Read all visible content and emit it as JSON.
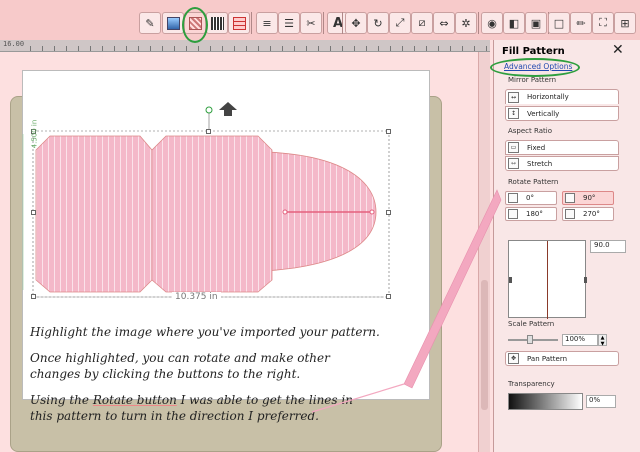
{
  "toolbar": {
    "buttons": [
      "fill-pen-icon",
      "color-swatch-icon",
      "fill-pattern-icon",
      "pattern-hatch-icon",
      "pattern-grid-icon",
      "line-style-icon",
      "dash-style-icon",
      "scissors-icon",
      "text-icon",
      "move-icon",
      "rotate-icon",
      "resize-icon",
      "slant-icon",
      "flip-icon",
      "weld-icon",
      "camera-icon",
      "layers-icon",
      "page-icon",
      "select-box-icon",
      "pencil-icon",
      "fullscreen-icon",
      "grid-icon"
    ],
    "text_glyph": "A"
  },
  "ruler": {
    "start_label": "16.00"
  },
  "canvas": {
    "height_label": "4.500 in",
    "width_label": "10.375 in"
  },
  "panel": {
    "title": "Fill Pattern",
    "close": "✕",
    "advanced_options": "Advanced Options",
    "mirror_pattern": "Mirror Pattern",
    "horizontally": "Horizontally",
    "vertically": "Vertically",
    "aspect_ratio": "Aspect Ratio",
    "fixed": "Fixed",
    "stretch": "Stretch",
    "rotate_pattern": "Rotate Pattern",
    "rot_0": "0°",
    "rot_90": "90°",
    "rot_180": "180°",
    "rot_270": "270°",
    "angle_value": "90.0",
    "scale_pattern": "Scale Pattern",
    "scale_value": "100%",
    "pan_pattern": "Pan Pattern",
    "transparency": "Transparency",
    "transparency_value": "0%"
  },
  "instructions": {
    "p1": "Highlight the image where you've imported your pattern.",
    "p2a": "Once highlighted, you can rotate and make other",
    "p2b": "changes by clicking the buttons to the right.",
    "p3a_pre": "Using the ",
    "p3a_link": "Rotate button",
    "p3a_post": " I was able to get the lines in",
    "p3b": "this pattern to turn in the direction I preferred."
  },
  "colors": {
    "accent_green": "#2e9e3e",
    "shape_pink": "#f4b8c9",
    "pointer_pink": "#f3a8c0"
  }
}
